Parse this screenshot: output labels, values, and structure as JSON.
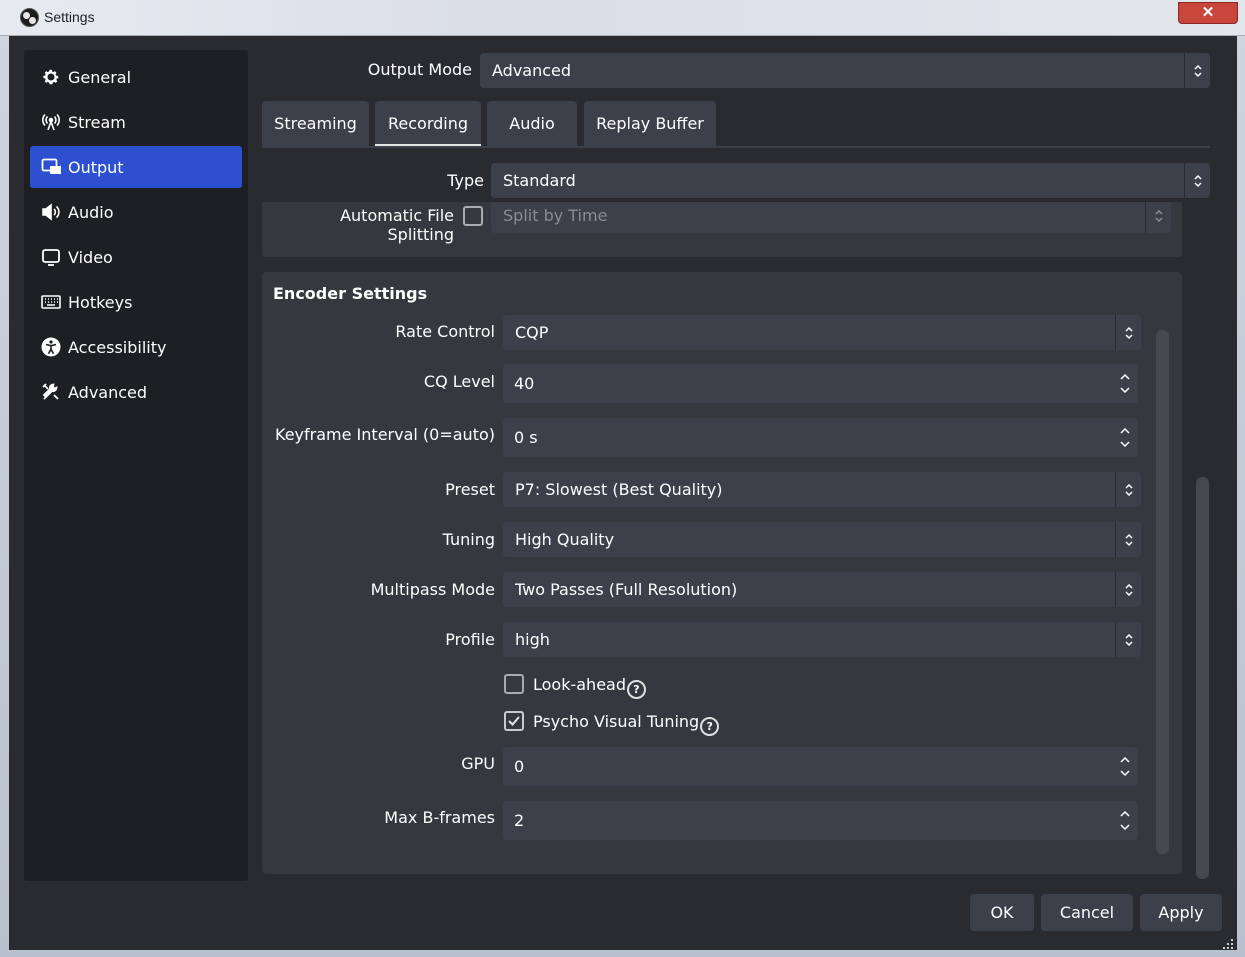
{
  "window": {
    "title": "Settings",
    "close_glyph": "✕"
  },
  "sidebar": {
    "items": [
      {
        "label": "General",
        "icon": "gear-icon"
      },
      {
        "label": "Stream",
        "icon": "antenna-icon"
      },
      {
        "label": "Output",
        "icon": "output-icon",
        "active": true
      },
      {
        "label": "Audio",
        "icon": "speaker-icon"
      },
      {
        "label": "Video",
        "icon": "monitor-icon"
      },
      {
        "label": "Hotkeys",
        "icon": "keyboard-icon"
      },
      {
        "label": "Accessibility",
        "icon": "accessibility-icon"
      },
      {
        "label": "Advanced",
        "icon": "tools-icon"
      }
    ]
  },
  "output": {
    "mode_label": "Output Mode",
    "mode_value": "Advanced",
    "tabs": [
      {
        "label": "Streaming"
      },
      {
        "label": "Recording",
        "active": true
      },
      {
        "label": "Audio"
      },
      {
        "label": "Replay Buffer"
      }
    ],
    "type_label": "Type",
    "type_value": "Standard",
    "splitting_label": "Automatic File Splitting",
    "splitting_value": "Split by Time",
    "splitting_checked": false
  },
  "encoder": {
    "title": "Encoder Settings",
    "rate_control": {
      "label": "Rate Control",
      "value": "CQP"
    },
    "cq_level": {
      "label": "CQ Level",
      "value": "40"
    },
    "keyframe": {
      "label": "Keyframe Interval (0=auto)",
      "value": "0 s"
    },
    "preset": {
      "label": "Preset",
      "value": "P7: Slowest (Best Quality)"
    },
    "tuning": {
      "label": "Tuning",
      "value": "High Quality"
    },
    "multipass": {
      "label": "Multipass Mode",
      "value": "Two Passes (Full Resolution)"
    },
    "profile": {
      "label": "Profile",
      "value": "high"
    },
    "lookahead": {
      "label": "Look-ahead",
      "checked": false,
      "help": "?"
    },
    "psycho": {
      "label": "Psycho Visual Tuning",
      "checked": true,
      "help": "?"
    },
    "gpu": {
      "label": "GPU",
      "value": "0"
    },
    "bframes": {
      "label": "Max B-frames",
      "value": "2"
    }
  },
  "buttons": {
    "ok": "OK",
    "cancel": "Cancel",
    "apply": "Apply"
  },
  "colors": {
    "accent": "#2c50d0",
    "background": "#2a2b30",
    "panel": "#36383f",
    "input": "#3c404b"
  }
}
